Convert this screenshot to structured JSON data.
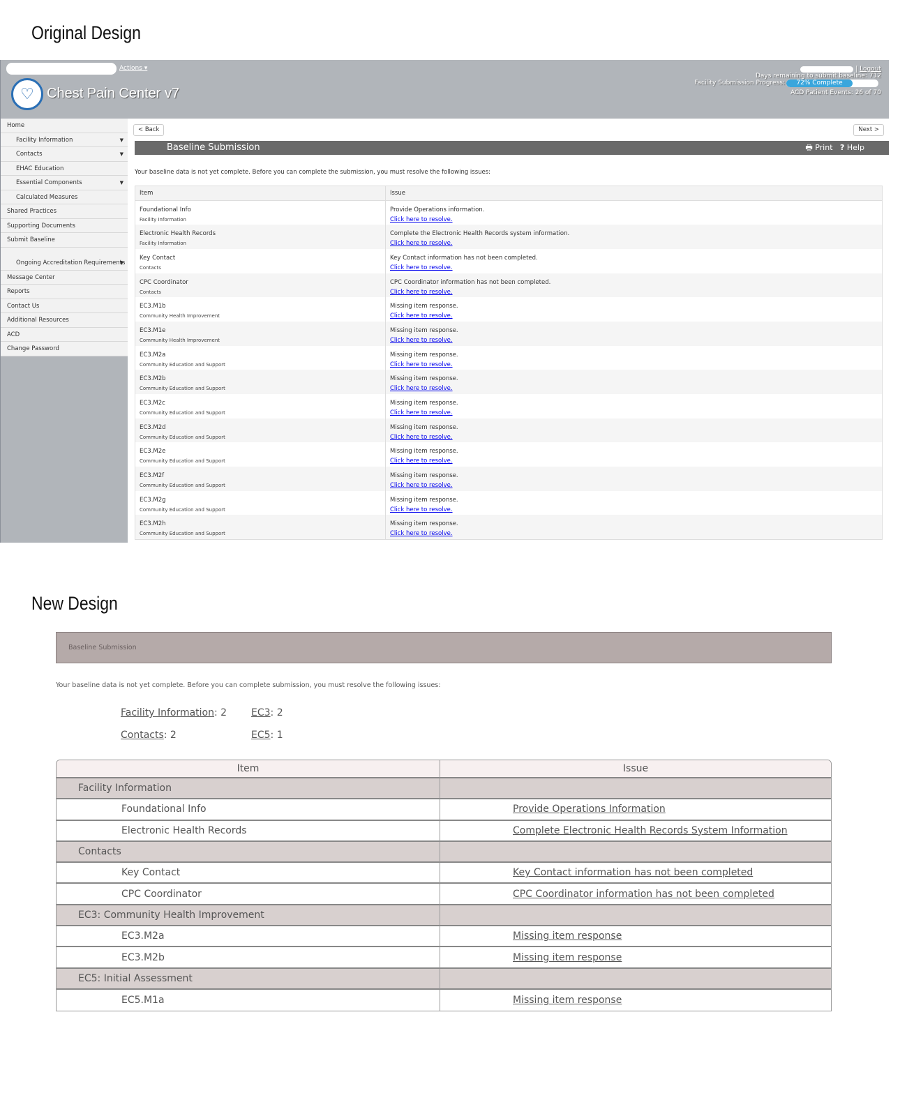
{
  "labels": {
    "original": "Original Design",
    "new": "New Design"
  },
  "header": {
    "actions": "Actions",
    "app_title": "Chest Pain Center v7",
    "logout": "Logout",
    "days_remaining": "Days remaining to submit baseline: 712",
    "progress_label": "Facility Submission Progress:",
    "progress_text": "72% Complete",
    "progress_percent": 72,
    "acd_events": "ACD Patient Events: 26 of 70",
    "progress_color": "#3aa6dc"
  },
  "sidebar": {
    "items": [
      {
        "label": "Home",
        "sub": false
      },
      {
        "label": "Facility Information",
        "sub": true,
        "caret": true
      },
      {
        "label": "Contacts",
        "sub": true,
        "caret": true
      },
      {
        "label": "EHAC Education",
        "sub": true
      },
      {
        "label": "Essential Components",
        "sub": true,
        "caret": true
      },
      {
        "label": "Calculated Measures",
        "sub": true
      },
      {
        "label": "Shared Practices"
      },
      {
        "label": "Supporting Documents"
      },
      {
        "label": "Submit Baseline"
      },
      {
        "label": "Ongoing Accreditation Requirements",
        "sub": true,
        "caret": true,
        "tall": true
      },
      {
        "label": "Message Center"
      },
      {
        "label": "Reports"
      },
      {
        "label": "Contact Us"
      },
      {
        "label": "Additional Resources"
      },
      {
        "label": "ACD"
      },
      {
        "label": "Change Password"
      }
    ]
  },
  "main": {
    "back": "< Back",
    "next": "Next >",
    "title": "Baseline Submission",
    "print": "Print",
    "help": "Help",
    "intro": "Your baseline data is not yet complete. Before you can complete the submission, you must resolve the following issues:",
    "columns": [
      "Item",
      "Issue"
    ],
    "link": "Click here to resolve.",
    "rows": [
      [
        "Foundational Info",
        "Facility Information",
        "Provide Operations information."
      ],
      [
        "Electronic Health Records",
        "Facility Information",
        "Complete the Electronic Health Records system information."
      ],
      [
        "Key Contact",
        "Contacts",
        "Key Contact information has not been completed."
      ],
      [
        "CPC Coordinator",
        "Contacts",
        "CPC Coordinator information has not been completed."
      ],
      [
        "EC3.M1b",
        "Community Health Improvement",
        "Missing item response."
      ],
      [
        "EC3.M1e",
        "Community Health Improvement",
        "Missing item response."
      ],
      [
        "EC3.M2a",
        "Community Education and Support",
        "Missing item response."
      ],
      [
        "EC3.M2b",
        "Community Education and Support",
        "Missing item response."
      ],
      [
        "EC3.M2c",
        "Community Education and Support",
        "Missing item response."
      ],
      [
        "EC3.M2d",
        "Community Education and Support",
        "Missing item response."
      ],
      [
        "EC3.M2e",
        "Community Education and Support",
        "Missing item response."
      ],
      [
        "EC3.M2f",
        "Community Education and Support",
        "Missing item response."
      ],
      [
        "EC3.M2g",
        "Community Education and Support",
        "Missing item response."
      ],
      [
        "EC3.M2h",
        "Community Education and Support",
        "Missing item response."
      ]
    ]
  },
  "new_design": {
    "banner": "Baseline Submission",
    "intro": "Your baseline data is not yet complete. Before you can complete submission, you must resolve the following issues:",
    "summary": [
      {
        "label": "Facility Information",
        "count": ": 2"
      },
      {
        "label": "EC3",
        "count": ": 2"
      },
      {
        "label": "Contacts",
        "count": ": 2"
      },
      {
        "label": "EC5",
        "count": ": 1"
      }
    ],
    "columns": [
      "Item",
      "Issue"
    ],
    "groups": [
      {
        "name": "Facility Information",
        "items": [
          [
            "Foundational Info",
            "Provide Operations Information"
          ],
          [
            "Electronic Health Records",
            "Complete Electronic Health Records System Information"
          ]
        ]
      },
      {
        "name": "Contacts",
        "items": [
          [
            "Key Contact",
            "Key Contact information has not been completed"
          ],
          [
            "CPC Coordinator",
            "CPC Coordinator information has not been completed"
          ]
        ]
      },
      {
        "name": "EC3: Community Health Improvement",
        "items": [
          [
            "EC3.M2a",
            "Missing item response"
          ],
          [
            "EC3.M2b",
            "Missing item response"
          ]
        ]
      },
      {
        "name": "EC5: Initial Assessment",
        "items": [
          [
            "EC5.M1a",
            "Missing item response"
          ]
        ]
      }
    ]
  }
}
